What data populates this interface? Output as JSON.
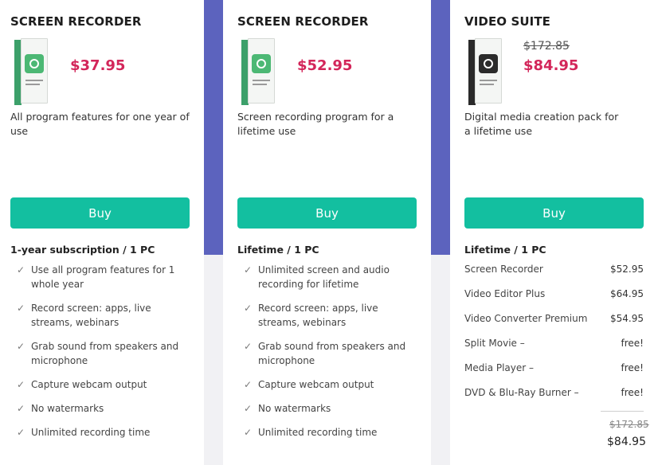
{
  "cards": [
    {
      "title": "SCREEN RECORDER",
      "price": "$37.95",
      "description": "All program features for one year of use",
      "buy_label": "Buy",
      "subscription": "1-year subscription / 1 PC",
      "features": [
        "Use all program features for 1 whole year",
        "Record screen: apps, live streams, webinars",
        "Grab sound from speakers and microphone",
        "Capture webcam output",
        "No watermarks",
        "Unlimited recording time"
      ]
    },
    {
      "title": "SCREEN RECORDER",
      "price": "$52.95",
      "description": "Screen recording program for a lifetime use",
      "buy_label": "Buy",
      "subscription": "Lifetime / 1 PC",
      "features": [
        "Unlimited screen and audio recording for lifetime",
        "Record screen: apps, live streams, webinars",
        "Grab sound from speakers and microphone",
        "Capture webcam output",
        "No watermarks",
        "Unlimited recording time"
      ]
    },
    {
      "title": "VIDEO SUITE",
      "old_price": "$172.85",
      "price": "$84.95",
      "description": "Digital media creation pack for a lifetime use",
      "buy_label": "Buy",
      "subscription": "Lifetime / 1 PC",
      "items": [
        {
          "name": "Screen Recorder",
          "value": "$52.95"
        },
        {
          "name": "Video Editor Plus",
          "value": "$64.95"
        },
        {
          "name": "Video Converter Premium",
          "value": "$54.95"
        },
        {
          "name": "Split Movie –",
          "value": "free!"
        },
        {
          "name": "Media Player –",
          "value": "free!"
        },
        {
          "name": "DVD & Blu-Ray Burner –",
          "value": "free!"
        }
      ],
      "total_old": "$172.85",
      "total": "$84.95"
    }
  ],
  "colors": {
    "accent_band": "#5c63be",
    "buy_button": "#13bfa0",
    "price": "#d3265a"
  },
  "icons": {
    "check": "check-icon",
    "product_box_green": "screen-recorder-box-icon",
    "product_box_dark": "video-suite-box-icon"
  }
}
